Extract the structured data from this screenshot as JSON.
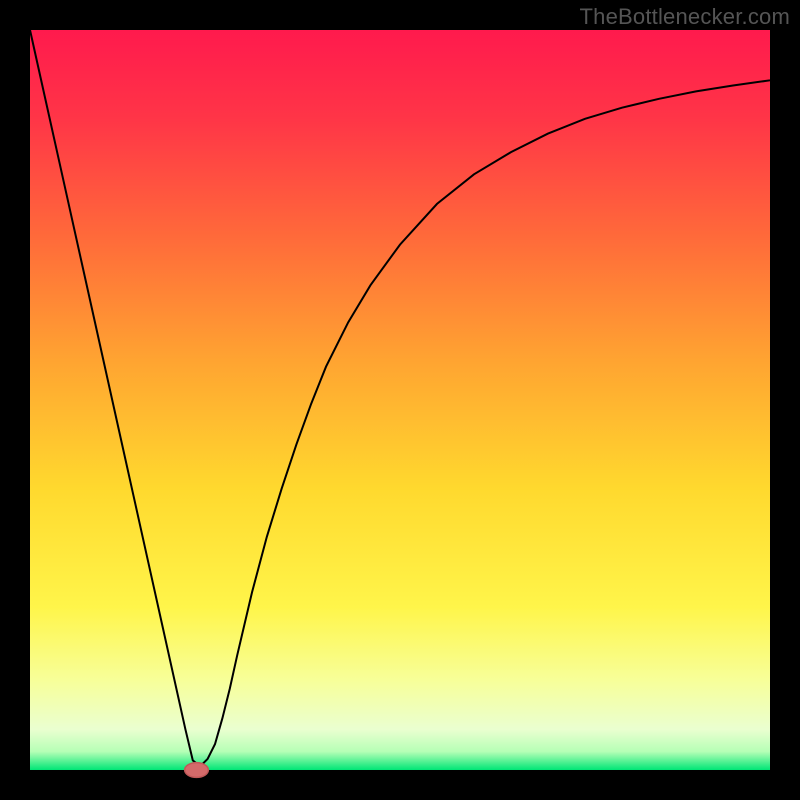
{
  "watermark": "TheBottlenecker.com",
  "chart_data": {
    "type": "line",
    "title": "",
    "xlabel": "",
    "ylabel": "",
    "xlim": [
      0,
      100
    ],
    "ylim": [
      0,
      100
    ],
    "background_gradient": {
      "stops": [
        {
          "offset": 0.0,
          "color": "#ff1a4d"
        },
        {
          "offset": 0.12,
          "color": "#ff3547"
        },
        {
          "offset": 0.28,
          "color": "#ff6a3a"
        },
        {
          "offset": 0.45,
          "color": "#ffa531"
        },
        {
          "offset": 0.62,
          "color": "#ffd92e"
        },
        {
          "offset": 0.78,
          "color": "#fff54a"
        },
        {
          "offset": 0.88,
          "color": "#f7ff9a"
        },
        {
          "offset": 0.945,
          "color": "#eaffd0"
        },
        {
          "offset": 0.975,
          "color": "#b6ffb6"
        },
        {
          "offset": 1.0,
          "color": "#00e676"
        }
      ]
    },
    "series": [
      {
        "name": "bottleneck-curve",
        "color": "#000000",
        "stroke_width": 2,
        "x": [
          0,
          2,
          4,
          6,
          8,
          10,
          12,
          14,
          16,
          18,
          20,
          21,
          22,
          23,
          24,
          25,
          26,
          27,
          28,
          30,
          32,
          34,
          36,
          38,
          40,
          43,
          46,
          50,
          55,
          60,
          65,
          70,
          75,
          80,
          85,
          90,
          95,
          100
        ],
        "y": [
          100,
          91,
          82,
          73,
          64,
          55,
          46,
          37,
          28,
          19,
          10,
          5.5,
          1.3,
          0.5,
          1.5,
          3.5,
          7,
          11,
          15.5,
          24,
          31.5,
          38,
          44,
          49.5,
          54.5,
          60.5,
          65.5,
          71,
          76.5,
          80.5,
          83.5,
          86,
          88,
          89.5,
          90.7,
          91.7,
          92.5,
          93.2
        ]
      }
    ],
    "marker": {
      "name": "optimal-point",
      "x": 22.5,
      "y": 0.0,
      "rx": 1.6,
      "ry": 1.0,
      "fill": "#d46a6a",
      "stroke": "#c05858"
    }
  }
}
